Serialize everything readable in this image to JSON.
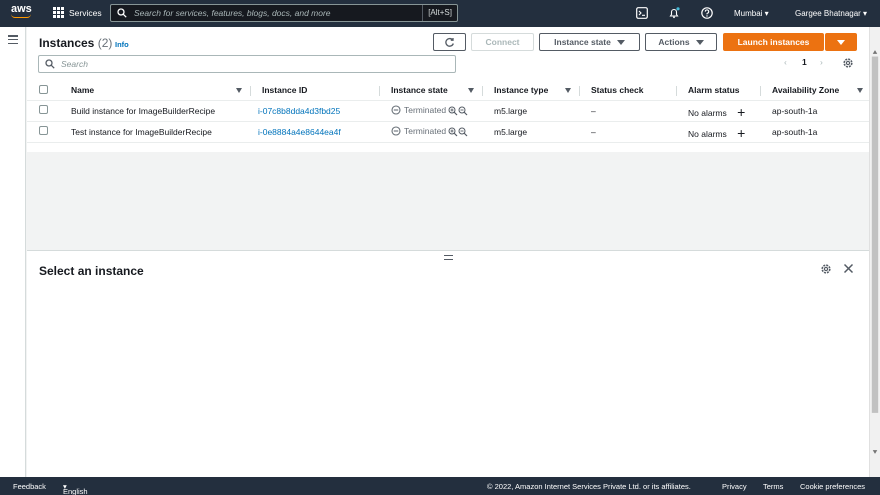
{
  "nav": {
    "logo": "aws",
    "services": "Services",
    "search_placeholder": "Search for services, features, blogs, docs, and more",
    "search_shortcut": "[Alt+S]",
    "region": "Mumbai",
    "user": "Gargee Bhatnagar",
    "icons": [
      "cloudshell-icon",
      "bell-icon",
      "help-icon"
    ]
  },
  "instances": {
    "title": "Instances",
    "count": "(2)",
    "info": "Info",
    "connect": "Connect",
    "instance_state": "Instance state",
    "actions": "Actions",
    "launch": "Launch instances",
    "filter_placeholder": "Search",
    "page": "1",
    "columns": [
      "Name",
      "Instance ID",
      "Instance state",
      "Instance type",
      "Status check",
      "Alarm status",
      "Availability Zone"
    ],
    "rows": [
      {
        "name": "Build instance for ImageBuilderRecipe",
        "id": "i-07c8b8dda4d3fbd25",
        "state": "Terminated",
        "type": "m5.large",
        "status": "–",
        "alarm": "No alarms",
        "az": "ap-south-1a"
      },
      {
        "name": "Test instance for ImageBuilderRecipe",
        "id": "i-0e8884a4e8644ea4f",
        "state": "Terminated",
        "type": "m5.large",
        "status": "–",
        "alarm": "No alarms",
        "az": "ap-south-1a"
      }
    ]
  },
  "details": {
    "title": "Select an instance"
  },
  "footer": {
    "feedback": "Feedback",
    "language": "English (US)",
    "copyright": "© 2022, Amazon Internet Services Private Ltd. or its affiliates.",
    "privacy": "Privacy",
    "terms": "Terms",
    "cookies": "Cookie preferences"
  },
  "colors": {
    "nav_bg": "#232f3e",
    "primary": "#ec7211",
    "link": "#0073bb"
  }
}
